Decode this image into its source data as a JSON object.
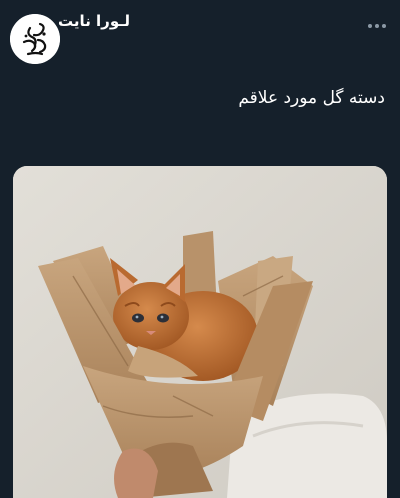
{
  "author": {
    "display_name": "لـورا نایت",
    "avatar_icon": "calligraphy-logo-icon",
    "avatar_text": "ری من بام"
  },
  "tweet": {
    "text": "دسته گل مورد علاقم"
  },
  "menu": {
    "icon": "more-options-icon"
  },
  "media": {
    "icon": "photo-icon",
    "subject": "kitten-in-kraft-paper-bouquet"
  },
  "colors": {
    "background": "#15202b",
    "text_primary": "#ffffff",
    "text_secondary": "#8b98a5"
  }
}
